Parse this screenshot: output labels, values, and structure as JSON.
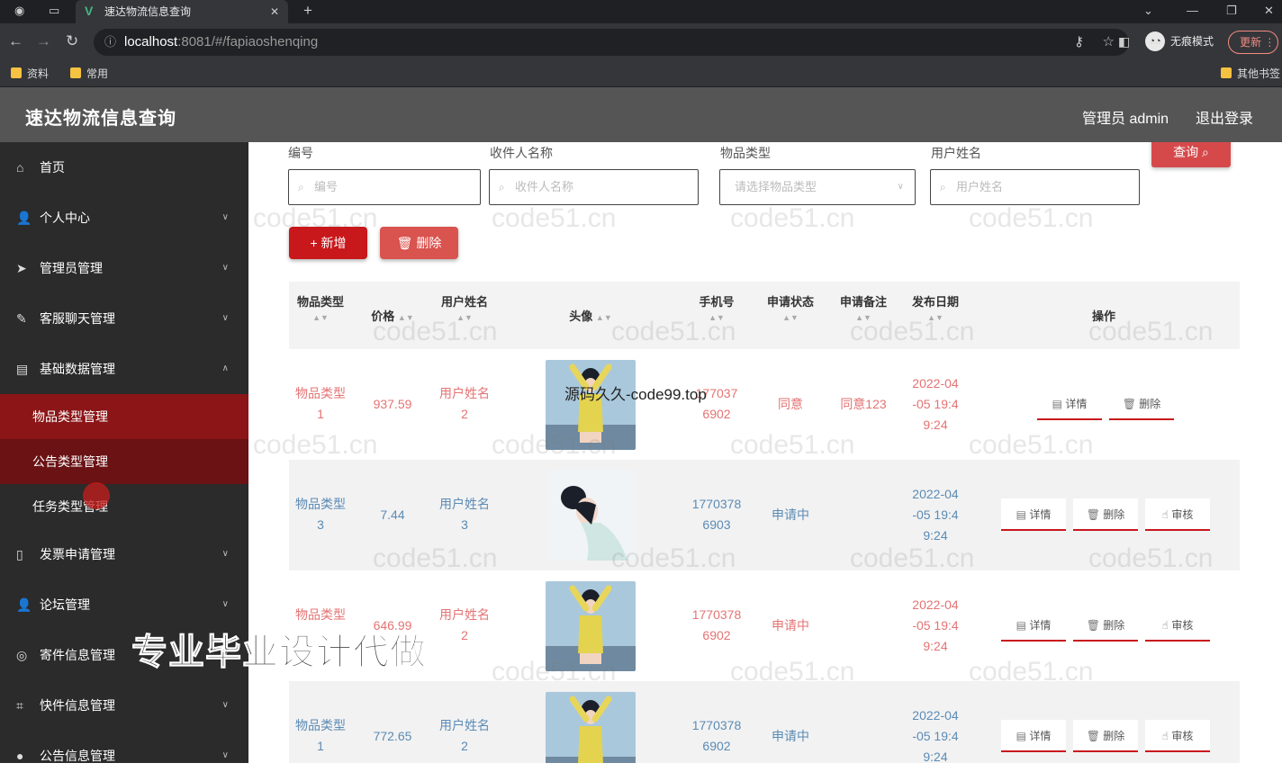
{
  "browser": {
    "tab_title": "速达物流信息查询",
    "tab_close": "✕",
    "new_tab": "+",
    "url_host": "localhost",
    "url_path": ":8081/#/fapiaoshenqing",
    "incognito_label": "无痕模式",
    "update_label": "更新",
    "bookmarks": [
      "资料",
      "常用"
    ],
    "other_bookmarks": "其他书签"
  },
  "header": {
    "title": "速达物流信息查询",
    "admin": "管理员 admin",
    "logout": "退出登录"
  },
  "sidebar": {
    "items": [
      {
        "label": "首页",
        "icon": "home-icon"
      },
      {
        "label": "个人中心",
        "icon": "user-icon"
      },
      {
        "label": "管理员管理",
        "icon": "send-icon"
      },
      {
        "label": "客服聊天管理",
        "icon": "edit-icon"
      },
      {
        "label": "基础数据管理",
        "icon": "stack-icon"
      }
    ],
    "sub_items": [
      "物品类型管理",
      "公告类型管理",
      "任务类型管理"
    ],
    "items_after": [
      {
        "label": "发票申请管理",
        "icon": "phone-icon"
      },
      {
        "label": "论坛管理",
        "icon": "user-icon"
      },
      {
        "label": "寄件信息管理",
        "icon": "circle-icon"
      },
      {
        "label": "快件信息管理",
        "icon": "crop-icon"
      },
      {
        "label": "公告信息管理",
        "icon": "pin-icon"
      }
    ]
  },
  "filters": {
    "f1_label": "编号",
    "f1_placeholder": "编号",
    "f2_label": "收件人名称",
    "f2_placeholder": "收件人名称",
    "f3_label": "物品类型",
    "f3_placeholder": "请选择物品类型",
    "f4_label": "用户姓名",
    "f4_placeholder": "用户姓名",
    "query": "查询 ⌕"
  },
  "actions": {
    "add": "+ 新增",
    "delete": "🗑 删除"
  },
  "table": {
    "headers": {
      "type": "物品类型",
      "price": "价格",
      "user": "用户姓名",
      "avatar": "头像",
      "phone": "手机号",
      "status": "申请状态",
      "remark": "申请备注",
      "date": "发布日期",
      "ops": "操作"
    },
    "sort_glyph": "▲▼",
    "rows": [
      {
        "type1": "物品类型",
        "type2": "1",
        "price": "937.59",
        "user1": "用户姓名",
        "user2": "2",
        "phone1": "177037",
        "phone2": "6902",
        "status": "同意",
        "remark": "同意123",
        "date1": "2022-04",
        "date2": "-05 19:4",
        "date3": "9:24",
        "tone": "red",
        "ops": [
          "详情",
          "删除"
        ]
      },
      {
        "type1": "物品类型",
        "type2": "3",
        "price": "7.44",
        "user1": "用户姓名",
        "user2": "3",
        "phone1": "1770378",
        "phone2": "6903",
        "status": "申请中",
        "remark": "",
        "date1": "2022-04",
        "date2": "-05 19:4",
        "date3": "9:24",
        "tone": "blue",
        "ops": [
          "详情",
          "删除",
          "审核"
        ]
      },
      {
        "type1": "物品类型",
        "type2": "",
        "price": "646.99",
        "user1": "用户姓名",
        "user2": "2",
        "phone1": "1770378",
        "phone2": "6902",
        "status": "申请中",
        "remark": "",
        "date1": "2022-04",
        "date2": "-05 19:4",
        "date3": "9:24",
        "tone": "red",
        "ops": [
          "详情",
          "删除",
          "审核"
        ]
      },
      {
        "type1": "物品类型",
        "type2": "1",
        "price": "772.65",
        "user1": "用户姓名",
        "user2": "2",
        "phone1": "1770378",
        "phone2": "6902",
        "status": "申请中",
        "remark": "",
        "date1": "2022-04",
        "date2": "-05 19:4",
        "date3": "9:24",
        "tone": "blue",
        "ops": [
          "详情",
          "删除",
          "审核"
        ]
      }
    ]
  },
  "overlay_text": "源码久久-code99.top",
  "banner_text": "专业毕业设计代做",
  "watermark": "code51.cn"
}
